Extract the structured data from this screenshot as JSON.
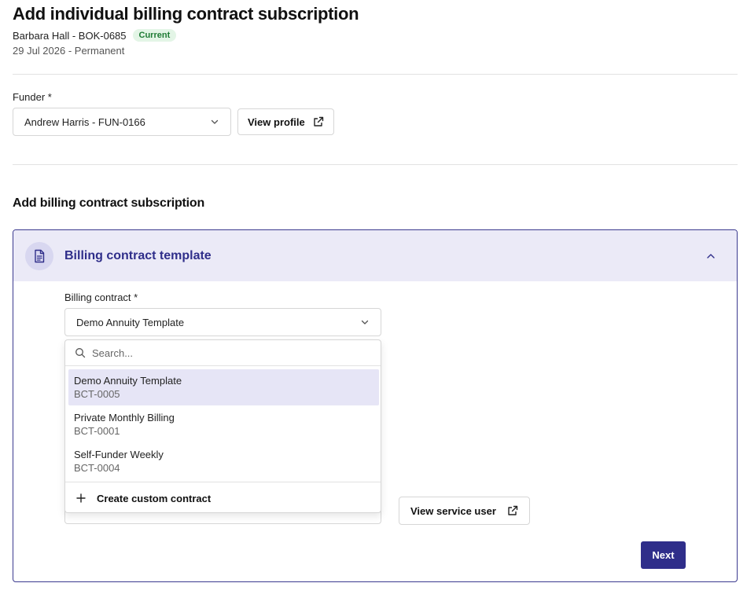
{
  "header": {
    "title": "Add individual billing contract subscription",
    "booking": "Barbara Hall - BOK-0685",
    "status_badge": "Current",
    "date_range": "29 Jul 2026 - Permanent"
  },
  "funder": {
    "label": "Funder *",
    "selected": "Andrew Harris - FUN-0166",
    "view_profile_label": "View profile"
  },
  "section": {
    "title": "Add billing contract subscription"
  },
  "card": {
    "title": "Billing contract template",
    "billing_contract_label": "Billing contract *",
    "billing_contract_selected": "Demo Annuity Template",
    "search_placeholder": "Search...",
    "options": [
      {
        "name": "Demo Annuity Template",
        "code": "BCT-0005"
      },
      {
        "name": "Private Monthly Billing",
        "code": "BCT-0001"
      },
      {
        "name": "Self-Funder Weekly",
        "code": "BCT-0004"
      }
    ],
    "create_custom_label": "Create custom contract",
    "view_service_user_label": "View service user",
    "next_label": "Next"
  },
  "colors": {
    "accent": "#2f2e8a",
    "header_bg": "#ebeaf7",
    "badge_bg": "#e3f5e6",
    "badge_text": "#1e7b34"
  }
}
